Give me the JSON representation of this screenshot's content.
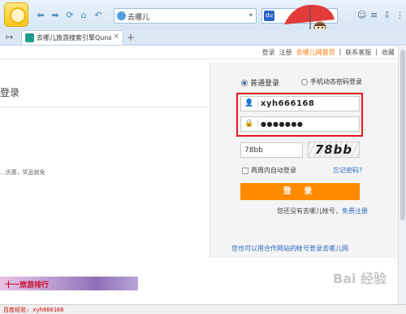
{
  "browser": {
    "address": "去哪儿",
    "tab_title": "去哪儿旅游搜索引擎Qunar",
    "tab_close": "×",
    "new_tab": "+",
    "nav_icons": [
      "back",
      "forward",
      "refresh",
      "home",
      "undo"
    ]
  },
  "header": {
    "links": [
      "登录",
      "注册",
      "去哪儿网首页",
      "联系客服",
      "收藏"
    ],
    "highlight_link": "去哪儿网首页"
  },
  "page": {
    "heading": "登录",
    "left_text": "...优惠，奖品就免",
    "banner_text": "十一旅游排行"
  },
  "login": {
    "mode_normal": "普通登录",
    "mode_sms": "手机动态密码登录",
    "username": "xyh666168",
    "password": "●●●●●●●",
    "captcha_value": "78bb",
    "captcha_image_text": "78bb",
    "auto_login": "两周内自动登录",
    "forgot": "忘记密码?",
    "submit": "登 录",
    "no_account": "您还没有去哪儿帐号，",
    "register_free": "免费注册",
    "partner_login": "您也可以用合作网站的帐号登录去哪儿网"
  },
  "status": {
    "text": "百度经验: xyh666168"
  },
  "colors": {
    "accent": "#ff8a00",
    "link": "#2a69b8",
    "highlight_box": "#e8171e"
  }
}
